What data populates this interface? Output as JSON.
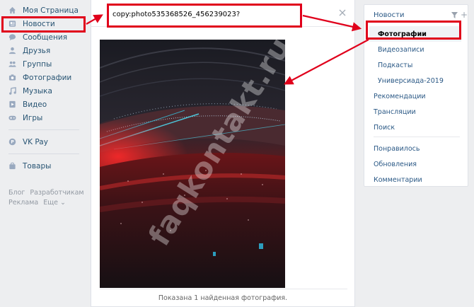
{
  "left_nav": {
    "items": [
      {
        "label": "Моя Страница",
        "icon": "home-icon"
      },
      {
        "label": "Новости",
        "icon": "news-icon"
      },
      {
        "label": "Сообщения",
        "icon": "messages-icon"
      },
      {
        "label": "Друзья",
        "icon": "friends-icon"
      },
      {
        "label": "Группы",
        "icon": "groups-icon"
      },
      {
        "label": "Фотографии",
        "icon": "camera-icon"
      },
      {
        "label": "Музыка",
        "icon": "music-icon"
      },
      {
        "label": "Видео",
        "icon": "video-icon"
      },
      {
        "label": "Игры",
        "icon": "gamepad-icon"
      }
    ],
    "vk_pay": {
      "label": "VK Pay",
      "icon": "vkpay-icon"
    },
    "goods": {
      "label": "Товары",
      "icon": "bag-icon"
    },
    "footer": {
      "blog": "Блог",
      "developers": "Разработчикам",
      "ads": "Реклама",
      "more": "Еще ⌄"
    }
  },
  "search": {
    "value": "copy:photo535368526_456239023?"
  },
  "result": {
    "text": "Показана 1 найденная фотография."
  },
  "right_menu": {
    "header": "Новости",
    "sub_items": [
      "Фотографии",
      "Видеозаписи",
      "Подкасты",
      "Универсиада-2019"
    ],
    "items_a": [
      "Рекомендации",
      "Трансляции",
      "Поиск"
    ],
    "items_b": [
      "Понравилось",
      "Обновления",
      "Комментарии"
    ]
  },
  "watermark": "faqkontakt.ru",
  "colors": {
    "accent": "#2a5885",
    "annotation": "#e0001b",
    "background": "#edeef0"
  }
}
